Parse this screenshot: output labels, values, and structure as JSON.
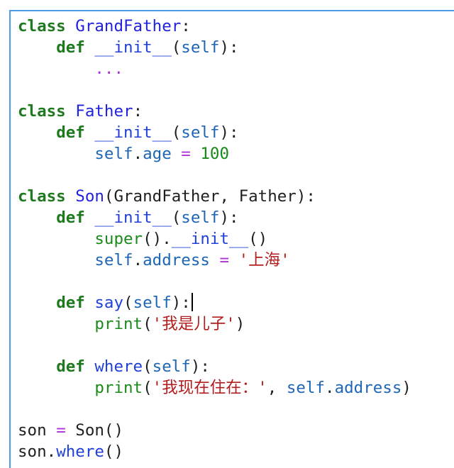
{
  "editor": {
    "lines": [
      {
        "parts": [
          {
            "t": "class",
            "c": "kw"
          },
          {
            "t": " ",
            "c": ""
          },
          {
            "t": "GrandFather",
            "c": "cls"
          },
          {
            "t": ":",
            "c": ""
          }
        ]
      },
      {
        "parts": [
          {
            "t": "    ",
            "c": ""
          },
          {
            "t": "def",
            "c": "kw"
          },
          {
            "t": " ",
            "c": ""
          },
          {
            "t": "__init__",
            "c": "fn"
          },
          {
            "t": "(",
            "c": ""
          },
          {
            "t": "self",
            "c": "self"
          },
          {
            "t": "):",
            "c": ""
          }
        ]
      },
      {
        "parts": [
          {
            "t": "        ",
            "c": ""
          },
          {
            "t": "...",
            "c": "dots"
          }
        ]
      },
      {
        "parts": []
      },
      {
        "parts": [
          {
            "t": "class",
            "c": "kw"
          },
          {
            "t": " ",
            "c": ""
          },
          {
            "t": "Father",
            "c": "cls"
          },
          {
            "t": ":",
            "c": ""
          }
        ]
      },
      {
        "parts": [
          {
            "t": "    ",
            "c": ""
          },
          {
            "t": "def",
            "c": "kw"
          },
          {
            "t": " ",
            "c": ""
          },
          {
            "t": "__init__",
            "c": "fn"
          },
          {
            "t": "(",
            "c": ""
          },
          {
            "t": "self",
            "c": "self"
          },
          {
            "t": "):",
            "c": ""
          }
        ]
      },
      {
        "parts": [
          {
            "t": "        ",
            "c": ""
          },
          {
            "t": "self",
            "c": "self"
          },
          {
            "t": ".",
            "c": ""
          },
          {
            "t": "age",
            "c": "self"
          },
          {
            "t": " ",
            "c": ""
          },
          {
            "t": "=",
            "c": "op"
          },
          {
            "t": " ",
            "c": ""
          },
          {
            "t": "100",
            "c": "num"
          }
        ]
      },
      {
        "parts": []
      },
      {
        "parts": [
          {
            "t": "class",
            "c": "kw"
          },
          {
            "t": " ",
            "c": ""
          },
          {
            "t": "Son",
            "c": "cls"
          },
          {
            "t": "(GrandFather, Father):",
            "c": ""
          }
        ]
      },
      {
        "parts": [
          {
            "t": "    ",
            "c": ""
          },
          {
            "t": "def",
            "c": "kw"
          },
          {
            "t": " ",
            "c": ""
          },
          {
            "t": "__init__",
            "c": "fn"
          },
          {
            "t": "(",
            "c": ""
          },
          {
            "t": "self",
            "c": "self"
          },
          {
            "t": "):",
            "c": ""
          }
        ]
      },
      {
        "parts": [
          {
            "t": "        ",
            "c": ""
          },
          {
            "t": "super",
            "c": "builtin"
          },
          {
            "t": "().",
            "c": ""
          },
          {
            "t": "__init__",
            "c": "fn"
          },
          {
            "t": "()",
            "c": ""
          }
        ]
      },
      {
        "parts": [
          {
            "t": "        ",
            "c": ""
          },
          {
            "t": "self",
            "c": "self"
          },
          {
            "t": ".",
            "c": ""
          },
          {
            "t": "address",
            "c": "self"
          },
          {
            "t": " ",
            "c": ""
          },
          {
            "t": "=",
            "c": "op"
          },
          {
            "t": " ",
            "c": ""
          },
          {
            "t": "'上海'",
            "c": "str"
          }
        ]
      },
      {
        "parts": []
      },
      {
        "parts": [
          {
            "t": "    ",
            "c": ""
          },
          {
            "t": "def",
            "c": "kw"
          },
          {
            "t": " ",
            "c": ""
          },
          {
            "t": "say",
            "c": "fn"
          },
          {
            "t": "(",
            "c": ""
          },
          {
            "t": "self",
            "c": "self"
          },
          {
            "t": "):",
            "c": ""
          }
        ],
        "caret": true
      },
      {
        "parts": [
          {
            "t": "        ",
            "c": ""
          },
          {
            "t": "print",
            "c": "builtin"
          },
          {
            "t": "(",
            "c": ""
          },
          {
            "t": "'我是儿子'",
            "c": "str"
          },
          {
            "t": ")",
            "c": ""
          }
        ]
      },
      {
        "parts": []
      },
      {
        "parts": [
          {
            "t": "    ",
            "c": ""
          },
          {
            "t": "def",
            "c": "kw"
          },
          {
            "t": " ",
            "c": ""
          },
          {
            "t": "where",
            "c": "fn"
          },
          {
            "t": "(",
            "c": ""
          },
          {
            "t": "self",
            "c": "self"
          },
          {
            "t": "):",
            "c": ""
          }
        ]
      },
      {
        "parts": [
          {
            "t": "        ",
            "c": ""
          },
          {
            "t": "print",
            "c": "builtin"
          },
          {
            "t": "(",
            "c": ""
          },
          {
            "t": "'我现在住在：'",
            "c": "str"
          },
          {
            "t": ", ",
            "c": ""
          },
          {
            "t": "self",
            "c": "self"
          },
          {
            "t": ".",
            "c": ""
          },
          {
            "t": "address",
            "c": "self"
          },
          {
            "t": ")",
            "c": ""
          }
        ]
      },
      {
        "parts": []
      },
      {
        "parts": [
          {
            "t": "son",
            "c": ""
          },
          {
            "t": " ",
            "c": ""
          },
          {
            "t": "=",
            "c": "op"
          },
          {
            "t": " ",
            "c": ""
          },
          {
            "t": "Son",
            "c": ""
          },
          {
            "t": "()",
            "c": ""
          }
        ]
      },
      {
        "parts": [
          {
            "t": "son",
            "c": ""
          },
          {
            "t": ".",
            "c": ""
          },
          {
            "t": "where",
            "c": "fn"
          },
          {
            "t": "()",
            "c": ""
          }
        ]
      }
    ]
  }
}
